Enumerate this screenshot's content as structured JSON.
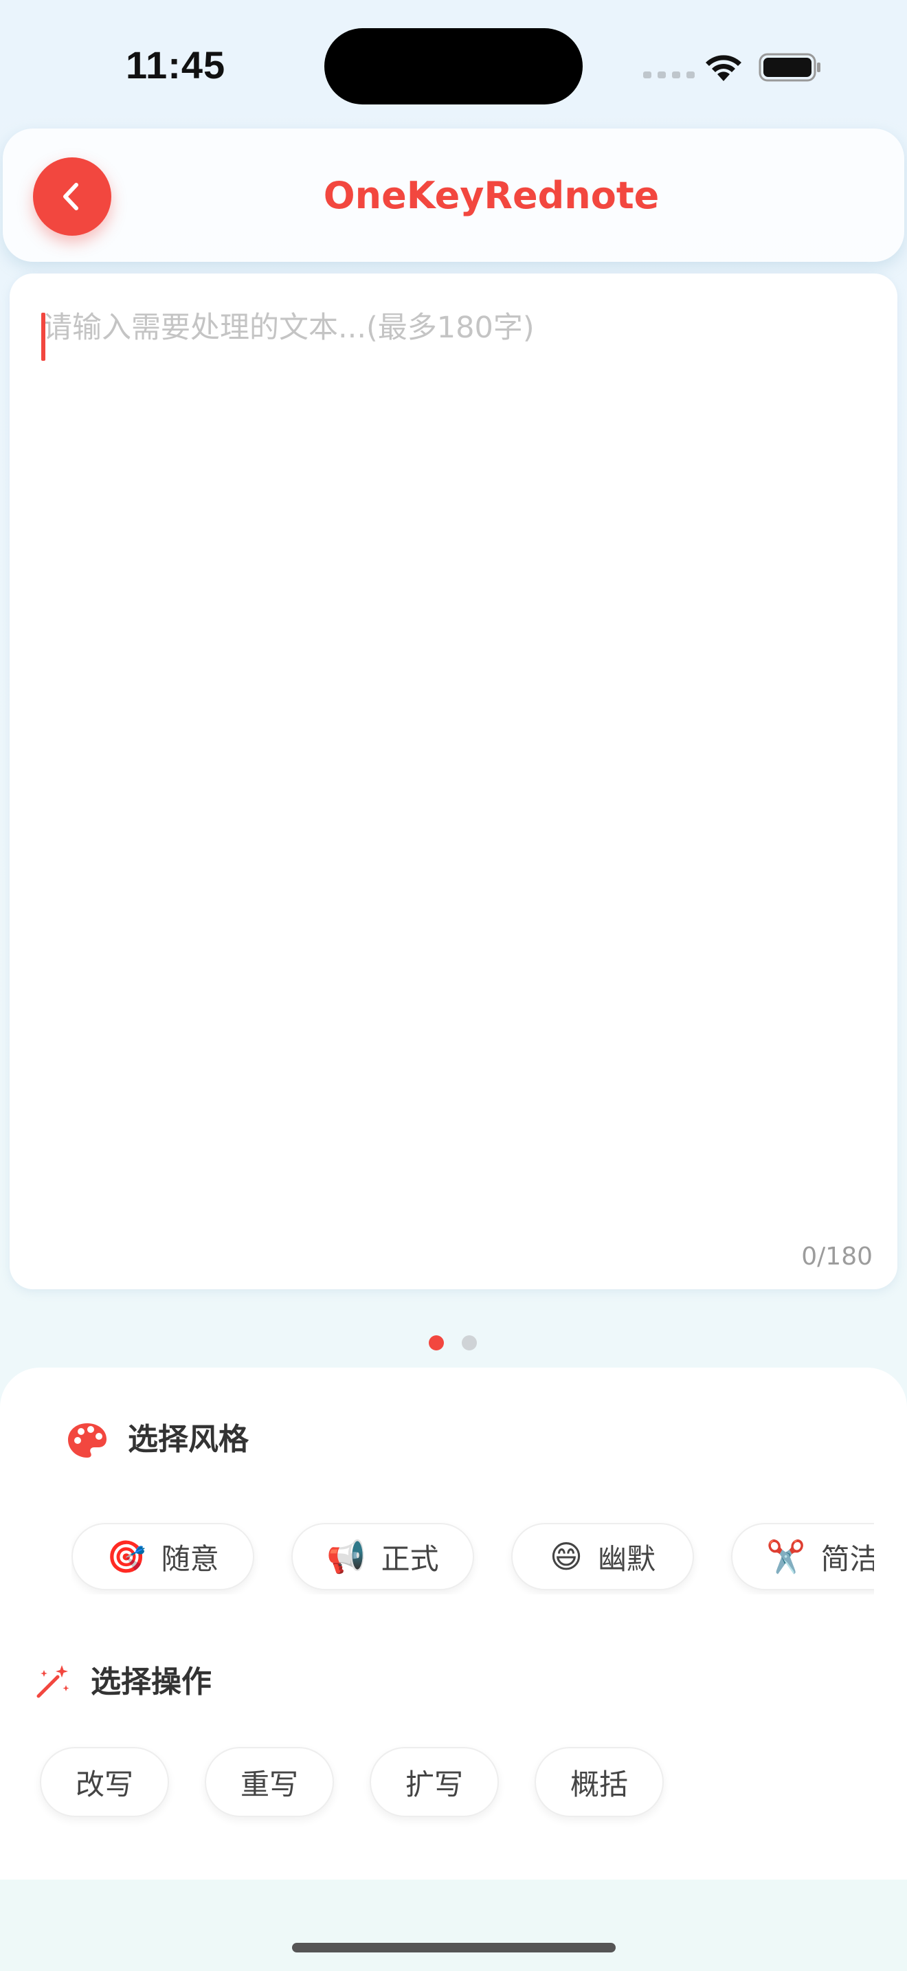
{
  "status_bar": {
    "time": "11:45"
  },
  "header": {
    "title": "OneKeyRednote"
  },
  "editor": {
    "placeholder": "请输入需要处理的文本...(最多180字)",
    "counter": "0/180"
  },
  "style_section": {
    "title": "选择风格",
    "options": [
      {
        "emoji": "🎯",
        "label": "随意"
      },
      {
        "emoji": "📢",
        "label": "正式"
      },
      {
        "emoji": "😄",
        "label": "幽默"
      },
      {
        "emoji": "✂️",
        "label": "简洁"
      }
    ]
  },
  "operation_section": {
    "title": "选择操作",
    "options": [
      "改写",
      "重写",
      "扩写",
      "概括"
    ]
  },
  "colors": {
    "accent": "#f2473f"
  }
}
